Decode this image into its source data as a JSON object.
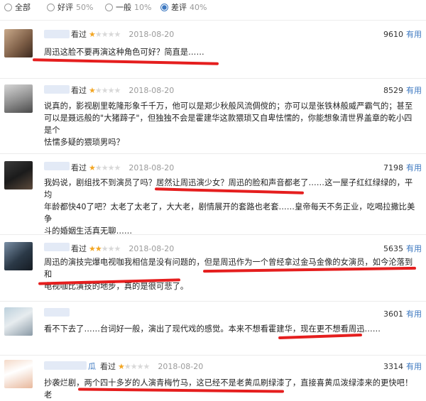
{
  "filters": [
    {
      "label": "全部",
      "pct": "",
      "selected": false
    },
    {
      "label": "好评",
      "pct": "50%",
      "selected": false
    },
    {
      "label": "一般",
      "pct": "10%",
      "selected": false
    },
    {
      "label": "差评",
      "pct": "40%",
      "selected": true
    }
  ],
  "reviews": [
    {
      "status": "看过",
      "stars": 1,
      "date": "2018-08-20",
      "votes": "9610",
      "useful": "有用",
      "lines": [
        "周迅这脸不要再演这种角色可好？简直是……"
      ]
    },
    {
      "status": "看过",
      "stars": 1,
      "date": "2018-08-20",
      "votes": "8529",
      "useful": "有用",
      "lines": [
        "说真的，影视剧里乾隆形象千千万，他可以是郑少秋般风流倜傥的；亦可以是张铁林般威严霸气的；甚至",
        "可以是聂远般的\"大猪蹄子\"，但独独不会是霍建华这款猥琐又自卑怯懦的，你能想象清世界盖章的乾小四是个",
        "怯懦多疑的猥琐男吗？"
      ]
    },
    {
      "status": "看过",
      "stars": 1,
      "date": "2018-08-20",
      "votes": "7198",
      "useful": "有用",
      "lines": [
        "我妈说，剧组找不到演员了吗？居然让周迅演少女？周迅的脸和声音都老了……这一屋子红红绿绿的，平均",
        "年龄都快40了吧？太老了太老了，大大老，剧情展开的套路也老套……皇帝每天不务正业，吃喝拉撒比美争",
        "斗的婚姻生活真无聊……"
      ]
    },
    {
      "status": "看过",
      "stars": 2,
      "date": "2018-08-20",
      "votes": "5635",
      "useful": "有用",
      "lines": [
        "周迅的演技完爆电视咖我相信是没有问题的，但是周迅作为一个曾经拿过金马金像的女演员，如今沦落到和",
        "电视咖比演技的地步，真的是很可悲了。"
      ]
    },
    {
      "status": "看过",
      "stars": 1,
      "date": "2018-08-20",
      "votes": "3601",
      "useful": "有用",
      "lines": [
        "看不下去了……台词好一般，演出了现代戏的感觉。本来不想看霍建华，现在更不想看周迅……"
      ]
    },
    {
      "status": "看过",
      "stars": 1,
      "date": "2018-08-20",
      "votes": "3314",
      "useful": "有用",
      "name_tail": "瓜",
      "lines": [
        "抄袭烂剧，两个四十多岁的人演青梅竹马，这已经不是老黄瓜刷绿漆了，直接喜黄瓜泼绿漆来的更快吧！老"
      ]
    }
  ]
}
